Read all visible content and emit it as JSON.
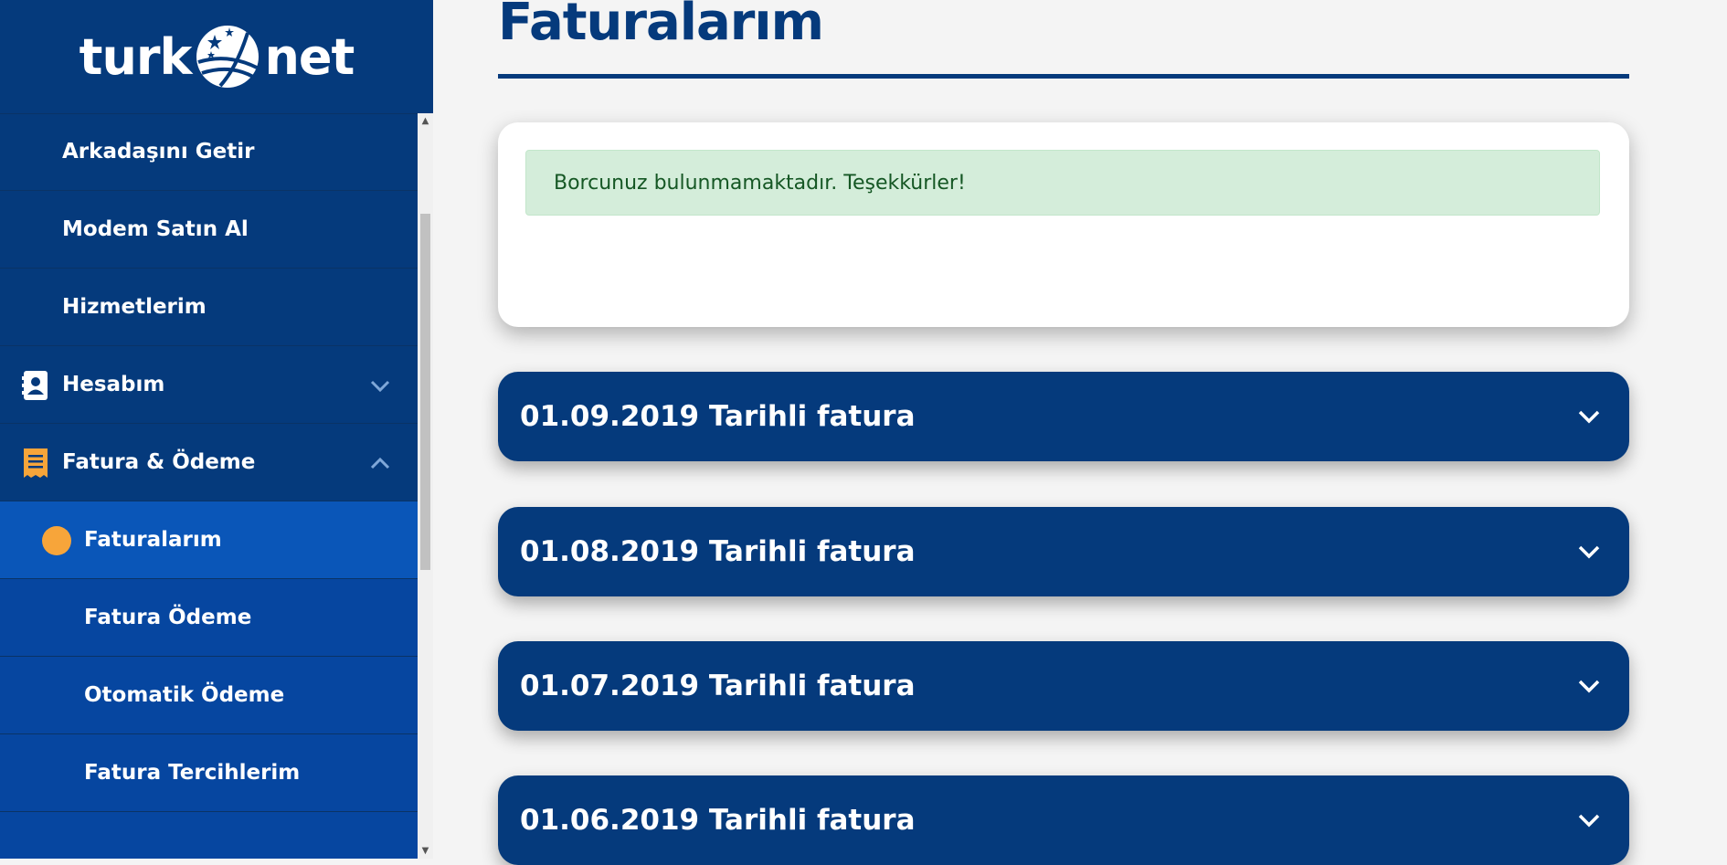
{
  "brand": {
    "logo_left": "turk",
    "logo_right": "net"
  },
  "sidebar": {
    "items": [
      {
        "label": "Arkadaşını Getir"
      },
      {
        "label": "Modem Satın Al"
      },
      {
        "label": "Hizmetlerim"
      },
      {
        "label": "Hesabım",
        "icon": "contact-card-icon",
        "expanded": false
      },
      {
        "label": "Fatura & Ödeme",
        "icon": "receipt-icon",
        "expanded": true,
        "icon_color": "#f7a53a"
      },
      {
        "label": "Faturalarım",
        "active": true
      },
      {
        "label": "Fatura Ödeme"
      },
      {
        "label": "Otomatik Ödeme"
      },
      {
        "label": "Fatura Tercihlerim"
      }
    ]
  },
  "page": {
    "title": "Faturalarım",
    "alert": "Borcunuz bulunmamaktadır. Teşekkürler!"
  },
  "invoices": [
    {
      "label": "01.09.2019 Tarihli fatura"
    },
    {
      "label": "01.08.2019 Tarihli fatura"
    },
    {
      "label": "01.07.2019 Tarihli fatura"
    },
    {
      "label": "01.06.2019 Tarihli fatura"
    }
  ],
  "colors": {
    "brand_navy": "#053a7c",
    "submenu_blue": "#0646a0",
    "active_blue": "#0a56b8",
    "accent_orange": "#f7a53a",
    "alert_green_bg": "#d4edda",
    "alert_green_text": "#155724"
  }
}
